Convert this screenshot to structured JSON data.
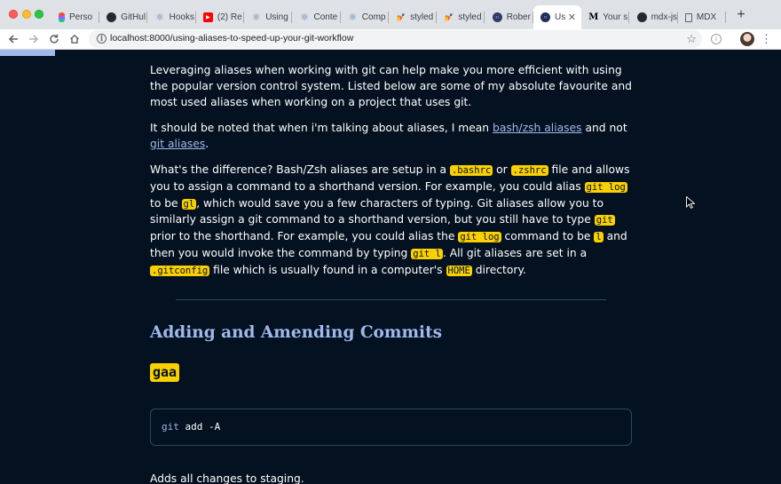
{
  "browser": {
    "tabs": [
      {
        "label": "Perso",
        "icon": "figma-icon",
        "color": "#f24e1e"
      },
      {
        "label": "GitHul",
        "icon": "github-icon",
        "color": "#24292e"
      },
      {
        "label": "Hooks",
        "icon": "react-icon",
        "color": "#3f7fbf"
      },
      {
        "label": "(2) Re",
        "icon": "youtube-icon",
        "color": "#ff0000"
      },
      {
        "label": "Using",
        "icon": "react-icon",
        "color": "#3f7fbf"
      },
      {
        "label": "Conte",
        "icon": "react-icon",
        "color": "#3f7fbf"
      },
      {
        "label": "Comp",
        "icon": "react-icon",
        "color": "#3f7fbf"
      },
      {
        "label": "styled",
        "icon": "styled-icon",
        "color": "#db7093"
      },
      {
        "label": "styled",
        "icon": "styled-icon",
        "color": "#db7093"
      },
      {
        "label": "Rober",
        "icon": "site-icon",
        "color": "#2d3b6b"
      },
      {
        "label": "Us",
        "icon": "code-icon",
        "color": "#1f2d5a",
        "active": true
      },
      {
        "label": "Your s",
        "icon": "medium-icon",
        "color": "#000000"
      },
      {
        "label": "mdx-js",
        "icon": "github-icon",
        "color": "#24292e"
      },
      {
        "label": "MDX",
        "icon": "document-icon",
        "color": "#5f6368"
      }
    ],
    "url": "localhost:8000/using-aliases-to-speed-up-your-git-workflow"
  },
  "article": {
    "p1": "Leveraging aliases when working with git can help make you more efficient with using the popular version control system. Listed below are some of my absolute favourite and most used aliases when working on a project that uses git.",
    "p2_before": "It should be noted that when i'm talking about aliases, I mean ",
    "p2_link1": "bash/zsh aliases",
    "p2_mid": " and not ",
    "p2_link2": "git aliases",
    "p2_end": ".",
    "p3": {
      "t1": "What's the difference? Bash/Zsh aliases are setup in a ",
      "c1": ".bashrc",
      "t2": " or ",
      "c2": ".zshrc",
      "t3": " file and allows you to assign a command to a shorthand version. For example, you could alias ",
      "c3": "git log",
      "t4": " to be ",
      "c4": "gl",
      "t5": ", which would save you a few characters of typing. Git aliases allow you to similarly assign a git command to a shorthand version, but you still have to type ",
      "c5": "git",
      "t6": " prior to the shorthand. For example, you could alias the ",
      "c6": "git log",
      "t7": " command to be ",
      "c7": "l",
      "t8": " and then you would invoke the command by typing ",
      "c8": "git l",
      "t9": ". All git aliases are set in a ",
      "c9": ".gitconfig",
      "t10": " file which is usually found in a computer's ",
      "c10": "HOME",
      "t11": " directory."
    },
    "heading": "Adding and Amending Commits",
    "alias": "gaa",
    "code": {
      "cmd": "git",
      "rest": " add ",
      "flag": "-A"
    },
    "after": "Adds all changes to staging."
  },
  "colors": {
    "background": "#041120",
    "link": "#9fb9ec",
    "code_highlight": "#fad000",
    "progress": "#9fb9ec"
  },
  "reading_progress": 0.07
}
